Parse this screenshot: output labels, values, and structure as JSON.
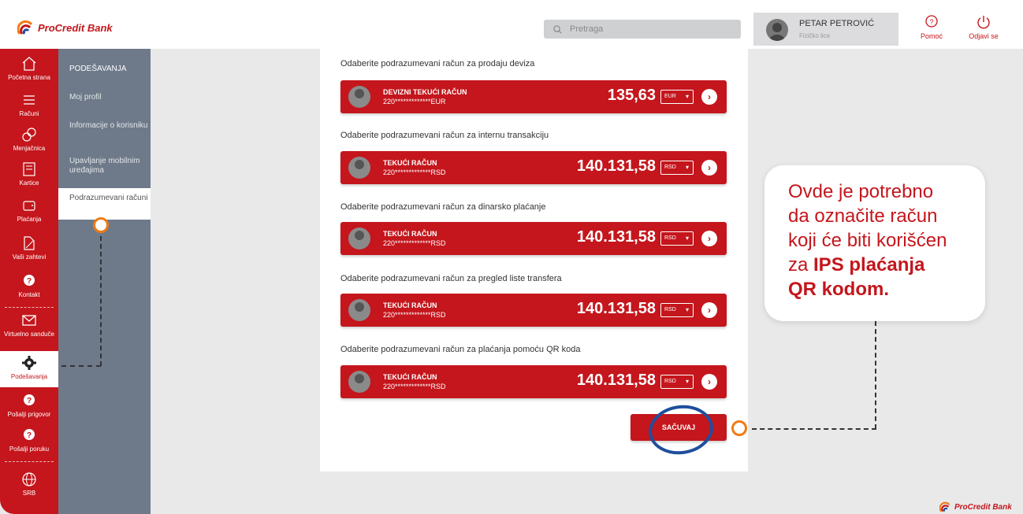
{
  "brand": {
    "name": "ProCredit Bank"
  },
  "search": {
    "placeholder": "Pretraga"
  },
  "user": {
    "name": "PETAR PETROVIĆ",
    "type": "Fizičko lice"
  },
  "header_actions": {
    "help": "Pomoć",
    "logout": "Odjavi se"
  },
  "nav": {
    "items": [
      {
        "label": "Početna strana",
        "icon": "home-icon"
      },
      {
        "label": "Računi",
        "icon": "list-icon"
      },
      {
        "label": "Menjačnica",
        "icon": "exchange-icon"
      },
      {
        "label": "Kartice",
        "icon": "card-icon"
      },
      {
        "label": "Plaćanja",
        "icon": "wallet-icon"
      },
      {
        "label": "Vaši zahtevi",
        "icon": "request-icon"
      },
      {
        "label": "Kontakt",
        "icon": "chat-icon"
      },
      {
        "label": "Virtuelno sanduče",
        "icon": "mail-icon"
      },
      {
        "label": "Podešavanja",
        "icon": "gear-icon"
      },
      {
        "label": "Pošalji prigovor",
        "icon": "complaint-icon"
      },
      {
        "label": "Pošalji poruku",
        "icon": "message-icon"
      },
      {
        "label": "SRB",
        "icon": "globe-icon"
      }
    ]
  },
  "subnav": {
    "title": "PODEŠAVANJA",
    "items": [
      "Moj profil",
      "Informacije o korisniku",
      "Upavljanje mobilnim uređajima",
      "Podrazumevani računi"
    ]
  },
  "sections": [
    {
      "label": "Odaberite podrazumevani račun za prodaju deviza",
      "account_name": "DEVIZNI TEKUĆI RAČUN",
      "account_number": "220*************EUR",
      "balance": "135,63",
      "currency": "EUR"
    },
    {
      "label": "Odaberite podrazumevani račun za internu transakciju",
      "account_name": "TEKUĆI RAČUN",
      "account_number": "220*************RSD",
      "balance": "140.131,58",
      "currency": "RSD"
    },
    {
      "label": "Odaberite podrazumevani račun za dinarsko plaćanje",
      "account_name": "TEKUĆI RAČUN",
      "account_number": "220*************RSD",
      "balance": "140.131,58",
      "currency": "RSD"
    },
    {
      "label": "Odaberite podrazumevani račun za pregled liste transfera",
      "account_name": "TEKUĆI RAČUN",
      "account_number": "220*************RSD",
      "balance": "140.131,58",
      "currency": "RSD"
    },
    {
      "label": "Odaberite podrazumevani račun za plaćanja pomoću QR koda",
      "account_name": "TEKUĆI RAČUN",
      "account_number": "220*************RSD",
      "balance": "140.131,58",
      "currency": "RSD"
    }
  ],
  "save_label": "SAČUVAJ",
  "callout": {
    "line1": "Ovde je potrebno",
    "line2": "da označite račun",
    "line3": "koji će biti korišćen",
    "line4_prefix": "za ",
    "line4_bold": "IPS plaćanja",
    "line5_bold": "QR kodom."
  },
  "colors": {
    "brand_red": "#c4161c",
    "sidebar_gray": "#6e7a8a",
    "highlight_orange": "#f07a14",
    "circle_blue": "#1f4e9c"
  }
}
